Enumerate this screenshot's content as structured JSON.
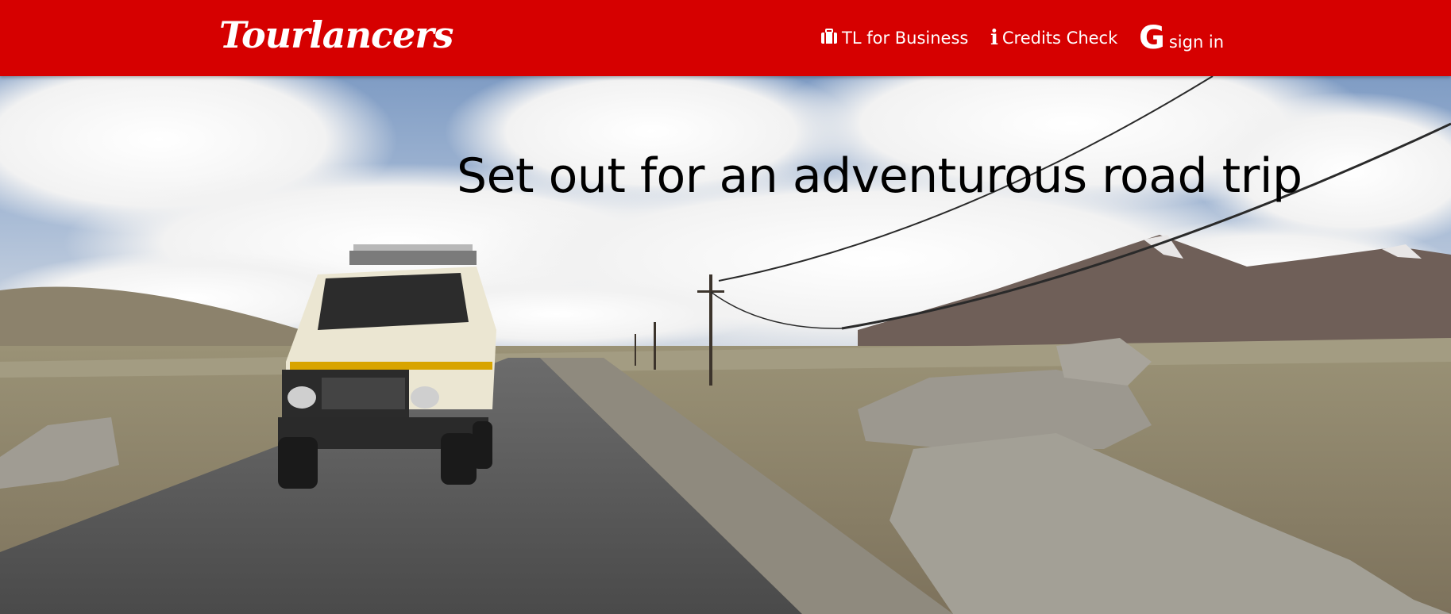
{
  "header": {
    "brand": "Tourlancers",
    "nav": [
      {
        "label": "TL for Business",
        "icon": "briefcase-icon"
      },
      {
        "label": "Credits Check",
        "icon": "info-icon"
      },
      {
        "label": "sign in",
        "icon": "google-icon"
      }
    ],
    "background_color": "#d60000"
  },
  "hero": {
    "headline": "Set out for an adventurous road trip"
  }
}
